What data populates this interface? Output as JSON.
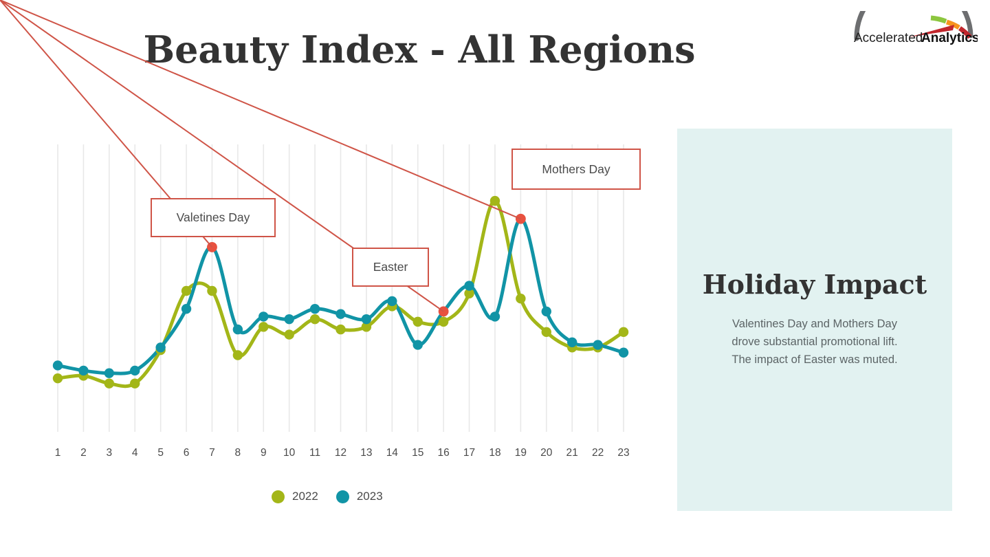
{
  "slide": {
    "title": "Beauty Index - All Regions",
    "background": "#ffffff"
  },
  "logo": {
    "name": "accelerated-analytics-logo",
    "text_light": "Accelerated",
    "text_bold": "Analytics",
    "arc_colors": [
      "#6d6e70",
      "#8cc63e",
      "#f7941e",
      "#c1272d"
    ],
    "needle_color": "#c1272d"
  },
  "info_panel": {
    "background": "#e2f2f1",
    "title": "Holiday Impact",
    "body_lines": [
      "Valentines Day and Mothers Day",
      "drove substantial promotional lift.",
      "The impact of Easter was muted."
    ]
  },
  "legend": {
    "position": "bottom-center",
    "items": [
      {
        "label": "2022",
        "color": "#a3b618"
      },
      {
        "label": "2023",
        "color": "#1194a6"
      }
    ]
  },
  "annotations": [
    {
      "id": "valentines",
      "label": "Valetines Day",
      "series": "2023",
      "point_index": 7,
      "marker_color": "#e8513f",
      "border_color": "#cf5447"
    },
    {
      "id": "easter",
      "label": "Easter",
      "series": "2023",
      "point_index": 16,
      "marker_color": "#e8513f",
      "border_color": "#cf5447"
    },
    {
      "id": "mothers",
      "label": "Mothers Day",
      "series": "2023",
      "point_index": 19,
      "marker_color": "#e8513f",
      "border_color": "#cf5447"
    }
  ],
  "chart_data": {
    "type": "line",
    "title": "Beauty Index - All Regions",
    "xlabel": "",
    "ylabel": "",
    "grid": "vertical",
    "legend_position": "bottom",
    "categories": [
      "1",
      "2",
      "3",
      "4",
      "5",
      "6",
      "7",
      "8",
      "9",
      "10",
      "11",
      "12",
      "13",
      "14",
      "15",
      "16",
      "17",
      "18",
      "19",
      "20",
      "21",
      "22",
      "23"
    ],
    "x": [
      1,
      2,
      3,
      4,
      5,
      6,
      7,
      8,
      9,
      10,
      11,
      12,
      13,
      14,
      15,
      16,
      17,
      18,
      19,
      20,
      21,
      22,
      23
    ],
    "ylim": [
      0,
      100
    ],
    "series": [
      {
        "name": "2022",
        "color": "#a3b618",
        "values": [
          16,
          17,
          14,
          14,
          27,
          50,
          50,
          25,
          36,
          33,
          39,
          35,
          36,
          44,
          38,
          38,
          49,
          85,
          47,
          34,
          28,
          28,
          34
        ]
      },
      {
        "name": "2023",
        "color": "#1194a6",
        "values": [
          21,
          19,
          18,
          19,
          28,
          43,
          67,
          35,
          40,
          39,
          43,
          41,
          39,
          46,
          29,
          42,
          52,
          40,
          78,
          42,
          30,
          29,
          26
        ]
      }
    ]
  }
}
